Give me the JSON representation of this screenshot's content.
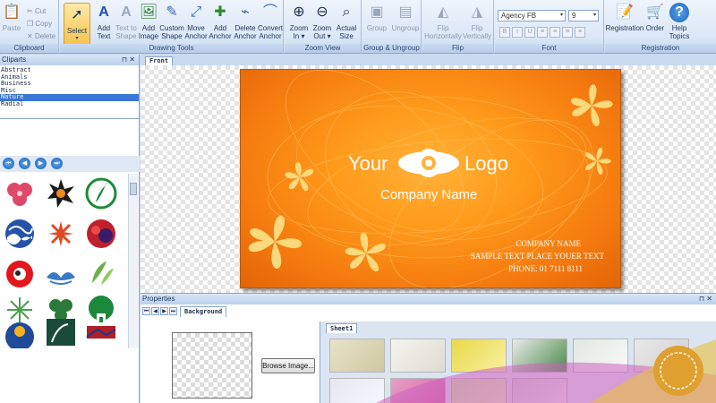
{
  "ribbon": {
    "clipboard": {
      "label": "Clipboard",
      "paste": "Paste",
      "cut": "Cut",
      "copy": "Copy",
      "delete": "Delete"
    },
    "drawing_tools": {
      "label": "Drawing Tools",
      "select": "Select",
      "add_text": [
        "Add",
        "Text"
      ],
      "text_to_shape": [
        "Text to",
        "Shape"
      ],
      "add_image": [
        "Add",
        "Image"
      ],
      "custom_shape": [
        "Custom",
        "Shape"
      ],
      "move_anchor": [
        "Move",
        "Anchor"
      ],
      "add_anchor": [
        "Add",
        "Anchor"
      ],
      "delete_anchor": [
        "Delete",
        "Anchor"
      ],
      "convert_anchor": [
        "Convert",
        "Anchor"
      ]
    },
    "zoom_view": {
      "label": "Zoom View",
      "zoom_in": [
        "Zoom",
        "In"
      ],
      "zoom_out": [
        "Zoom",
        "Out"
      ],
      "actual_size": [
        "Actual",
        "Size"
      ]
    },
    "group": {
      "label": "Group & Ungroup",
      "group": "Group",
      "ungroup": "Ungroup"
    },
    "flip": {
      "label": "Flip",
      "horizontal": [
        "Flip",
        "Horizontally"
      ],
      "vertical": [
        "Flip",
        "Vertically"
      ]
    },
    "font": {
      "label": "Font",
      "family": "Agency FB",
      "size": "9",
      "format_buttons": [
        "B",
        "I",
        "U",
        "≡",
        "≡",
        "≡",
        "≡"
      ]
    },
    "registration": {
      "label": "Registration",
      "registration": "Registration",
      "order": "Order",
      "help": [
        "Help",
        "Topics"
      ]
    }
  },
  "cliparts": {
    "title": "Cliparts",
    "categories": [
      "Abstract",
      "Animals",
      "Business",
      "Misc",
      "Nature",
      "Radial"
    ],
    "selected": "Nature"
  },
  "canvas": {
    "tab": "Front",
    "card": {
      "logo_left": "Your",
      "logo_right": "Logo",
      "company": "Company Name",
      "line1": "COMPANY NAME",
      "line2": "SAMPLE TEXT PLACE YOUER TEXT",
      "line3": "PHONE: 01 7111 8111"
    }
  },
  "properties": {
    "title": "Properties",
    "tab": "Background",
    "browse": "Browse Image...",
    "sheet_tab": "Sheet1"
  },
  "colors": {
    "ribbon_bg": "#dbe7f7",
    "card_orange": "#f57c10",
    "petal": "#fcd97a",
    "selection": "#3a78d8"
  }
}
